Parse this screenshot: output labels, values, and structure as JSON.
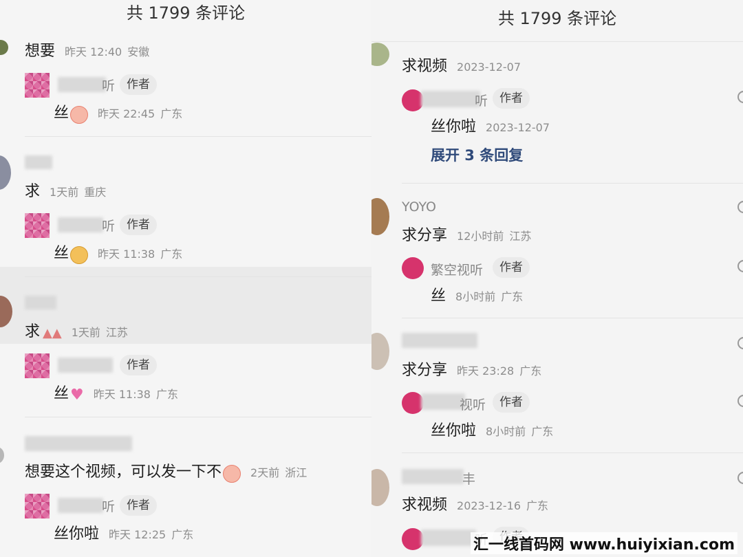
{
  "left": {
    "header": "共 1799 条评论",
    "c1": {
      "text": "想要",
      "time": "昨天 12:40",
      "loc": "安徽",
      "reply": {
        "name": "听",
        "tag": "作者",
        "text": "丝",
        "time": "昨天 22:45",
        "loc": "广东"
      }
    },
    "c2": {
      "text": "求",
      "time": "1天前",
      "loc": "重庆",
      "reply": {
        "name": "听",
        "tag": "作者",
        "text": "丝",
        "time": "昨天 11:38",
        "loc": "广东"
      }
    },
    "c3": {
      "text": "求",
      "time": "1天前",
      "loc": "江苏",
      "reply": {
        "tag": "作者",
        "text": "丝",
        "time": "昨天 11:38",
        "loc": "广东"
      }
    },
    "c4": {
      "text": "想要这个视频，可以发一下不",
      "time": "2天前",
      "loc": "浙江",
      "reply": {
        "name": "听",
        "tag": "作者",
        "text": "丝你啦",
        "time": "昨天 12:25",
        "loc": "广东"
      }
    }
  },
  "right": {
    "header": "共 1799 条评论",
    "c1": {
      "text": "求视频",
      "time": "2023-12-07",
      "reply": {
        "name": "听",
        "tag": "作者",
        "text": "丝你啦",
        "time": "2023-12-07"
      },
      "expand": "展开 3 条回复"
    },
    "c2": {
      "user": "YOYO",
      "text": "求分享",
      "time": "12小时前",
      "loc": "江苏",
      "reply": {
        "name": "繁空视听",
        "tag": "作者",
        "text": "丝",
        "time": "8小时前",
        "loc": "广东"
      }
    },
    "c3": {
      "text": "求分享",
      "time": "昨天 23:28",
      "loc": "广东",
      "reply": {
        "name": "视听",
        "tag": "作者",
        "text": "丝你啦",
        "time": "8小时前",
        "loc": "广东"
      }
    },
    "c4": {
      "user": "丰",
      "text": "求视频",
      "time": "2023-12-16",
      "loc": "广东",
      "reply": {
        "name": "听",
        "tag": "作者"
      }
    }
  },
  "watermark": "汇一线首码网 www.huiyixian.com"
}
